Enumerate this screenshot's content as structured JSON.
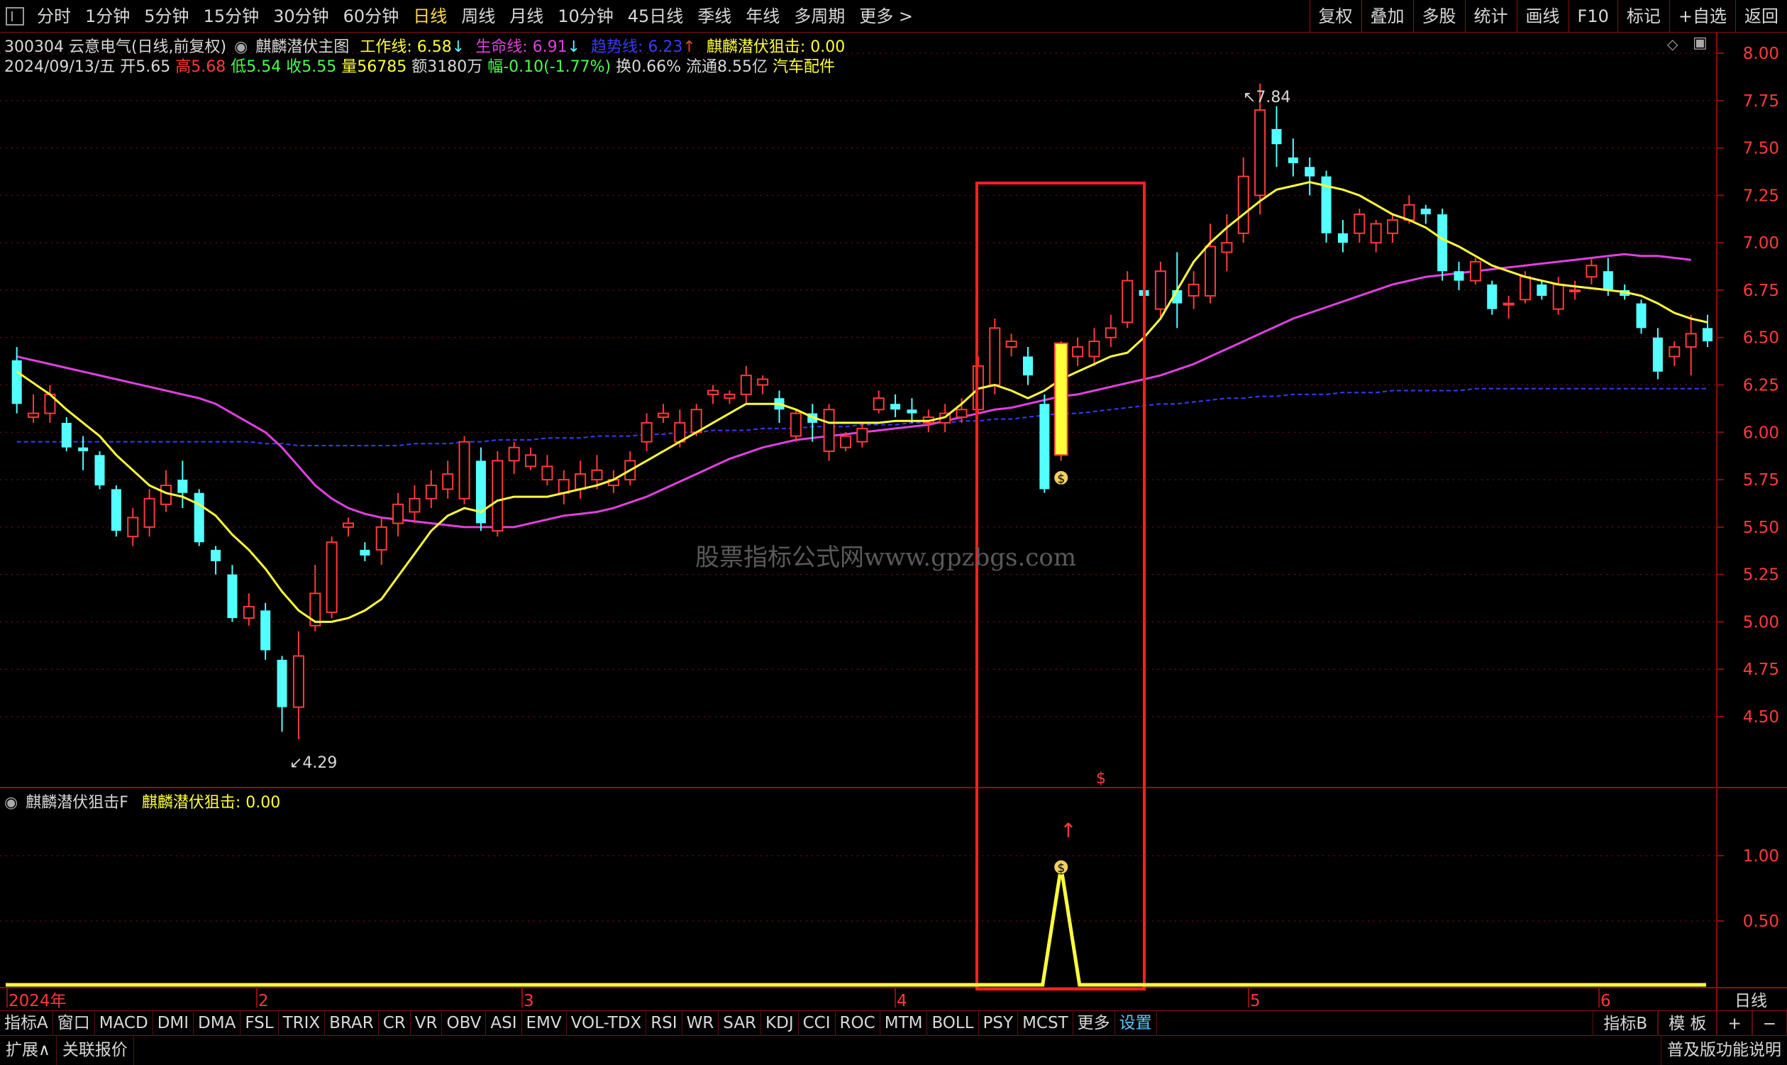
{
  "toolbar": {
    "periods": [
      "分时",
      "1分钟",
      "5分钟",
      "15分钟",
      "30分钟",
      "60分钟",
      "日线",
      "周线",
      "月线",
      "10分钟",
      "45日线",
      "季线",
      "年线",
      "多周期",
      "更多 >"
    ],
    "active_period": "日线",
    "right_tools": [
      "复权",
      "叠加",
      "多股",
      "统计",
      "画线",
      "F10",
      "标记",
      "+自选",
      "返回"
    ]
  },
  "header": {
    "stock": "300304 云意电气(日线,前复权)",
    "indicator_name": "麒麟潜伏主图",
    "work_line": "工作线: 6.58",
    "life_line": "生命线: 6.91",
    "trend_line": "趋势线: 6.23",
    "strike": "麒麟潜伏狙击: 0.00",
    "info_date": "2024/09/13/五",
    "info_open": "开5.65",
    "info_high": "高5.68",
    "info_low": "低5.54",
    "info_close": "收5.55",
    "info_vol": "量56785",
    "info_amount": "额3180万",
    "info_change": "幅-0.10(-1.77%)",
    "info_turnover": "换0.66%",
    "info_float": "流通8.55亿",
    "info_sector": "汽车配件"
  },
  "annotations": {
    "max_label": "7.84",
    "min_label": "4.29",
    "signal_glyph": "$"
  },
  "sub_panel": {
    "title": "麒麟潜伏狙击F",
    "value_label": "麒麟潜伏狙击: 0.00"
  },
  "axis_labels": {
    "month_labels": [
      "2024年",
      "2",
      "3",
      "4",
      "5",
      "6"
    ],
    "period_box": "日线"
  },
  "watermark": "股票指标公式网www.gpzbgs.com",
  "bottom_tabs": [
    "指标A",
    "窗口",
    "MACD",
    "DMI",
    "DMA",
    "FSL",
    "TRIX",
    "BRAR",
    "CR",
    "VR",
    "OBV",
    "ASI",
    "EMV",
    "VOL-TDX",
    "RSI",
    "WR",
    "SAR",
    "KDJ",
    "CCI",
    "ROC",
    "MTM",
    "BOLL",
    "PSY",
    "MCST",
    "更多",
    "设置"
  ],
  "bottom_right": [
    "指标B",
    "模 板",
    "+",
    "−"
  ],
  "status": {
    "expand": "扩展∧",
    "related": "关联报价",
    "right": "普及版功能说明"
  },
  "colors": {
    "up": "#ff3a3a",
    "down": "#54ffff",
    "yellow": "#ffff3a",
    "magenta": "#e040e0",
    "blue": "#3a3aff",
    "grid": "#8a1010",
    "signal_box": "#ff2020"
  },
  "chart_data": [
    {
      "type": "candlestick",
      "title": "麒麟潜伏主图",
      "ylim": [
        4.25,
        8.05
      ],
      "y_ticks": [
        8.0,
        7.75,
        7.5,
        7.25,
        7.0,
        6.75,
        6.5,
        6.25,
        6.0,
        5.75,
        5.5,
        5.25,
        5.0,
        4.75,
        4.5
      ],
      "candles": [
        [
          6.38,
          6.15,
          6.45,
          6.1
        ],
        [
          6.08,
          6.1,
          6.2,
          6.05
        ],
        [
          6.1,
          6.2,
          6.25,
          6.05
        ],
        [
          6.05,
          5.92,
          6.08,
          5.9
        ],
        [
          5.92,
          5.9,
          5.98,
          5.8
        ],
        [
          5.88,
          5.72,
          5.9,
          5.7
        ],
        [
          5.7,
          5.48,
          5.72,
          5.45
        ],
        [
          5.45,
          5.55,
          5.6,
          5.4
        ],
        [
          5.5,
          5.65,
          5.7,
          5.45
        ],
        [
          5.62,
          5.72,
          5.8,
          5.58
        ],
        [
          5.75,
          5.68,
          5.85,
          5.6
        ],
        [
          5.68,
          5.42,
          5.7,
          5.4
        ],
        [
          5.38,
          5.32,
          5.4,
          5.25
        ],
        [
          5.25,
          5.02,
          5.3,
          5.0
        ],
        [
          5.02,
          5.08,
          5.15,
          4.98
        ],
        [
          5.06,
          4.85,
          5.1,
          4.8
        ],
        [
          4.8,
          4.55,
          4.82,
          4.42
        ],
        [
          4.55,
          4.82,
          4.95,
          4.38
        ],
        [
          4.98,
          5.15,
          5.3,
          4.95
        ],
        [
          5.05,
          5.42,
          5.45,
          5.02
        ],
        [
          5.5,
          5.52,
          5.55,
          5.45
        ],
        [
          5.38,
          5.35,
          5.42,
          5.32
        ],
        [
          5.38,
          5.5,
          5.55,
          5.3
        ],
        [
          5.52,
          5.62,
          5.68,
          5.45
        ],
        [
          5.58,
          5.65,
          5.72,
          5.52
        ],
        [
          5.65,
          5.72,
          5.8,
          5.6
        ],
        [
          5.7,
          5.78,
          5.85,
          5.65
        ],
        [
          5.65,
          5.95,
          5.98,
          5.62
        ],
        [
          5.85,
          5.52,
          5.92,
          5.48
        ],
        [
          5.48,
          5.85,
          5.9,
          5.45
        ],
        [
          5.85,
          5.92,
          5.95,
          5.78
        ],
        [
          5.82,
          5.88,
          5.92,
          5.8
        ],
        [
          5.75,
          5.82,
          5.88,
          5.72
        ],
        [
          5.68,
          5.75,
          5.8,
          5.62
        ],
        [
          5.7,
          5.78,
          5.85,
          5.65
        ],
        [
          5.75,
          5.8,
          5.88,
          5.7
        ],
        [
          5.72,
          5.75,
          5.8,
          5.68
        ],
        [
          5.75,
          5.85,
          5.9,
          5.72
        ],
        [
          5.95,
          6.05,
          6.1,
          5.9
        ],
        [
          6.08,
          6.1,
          6.15,
          6.05
        ],
        [
          5.95,
          6.05,
          6.12,
          5.92
        ],
        [
          6.0,
          6.12,
          6.15,
          5.98
        ],
        [
          6.2,
          6.22,
          6.25,
          6.15
        ],
        [
          6.18,
          6.2,
          6.22,
          6.15
        ],
        [
          6.2,
          6.3,
          6.35,
          6.15
        ],
        [
          6.25,
          6.28,
          6.3,
          6.2
        ],
        [
          6.18,
          6.12,
          6.22,
          6.05
        ],
        [
          5.98,
          6.1,
          6.12,
          5.95
        ],
        [
          6.1,
          6.05,
          6.15,
          5.95
        ],
        [
          5.9,
          6.12,
          6.15,
          5.85
        ],
        [
          5.92,
          5.98,
          6.0,
          5.9
        ],
        [
          5.95,
          6.02,
          6.05,
          5.92
        ],
        [
          6.12,
          6.18,
          6.22,
          6.1
        ],
        [
          6.15,
          6.12,
          6.2,
          6.08
        ],
        [
          6.12,
          6.1,
          6.18,
          6.05
        ],
        [
          6.05,
          6.08,
          6.12,
          6.0
        ],
        [
          6.05,
          6.1,
          6.15,
          6.0
        ],
        [
          6.08,
          6.12,
          6.18,
          6.05
        ],
        [
          6.12,
          6.35,
          6.4,
          6.1
        ],
        [
          6.25,
          6.55,
          6.6,
          6.2
        ],
        [
          6.45,
          6.48,
          6.52,
          6.4
        ],
        [
          6.4,
          6.3,
          6.45,
          6.25
        ],
        [
          6.15,
          5.7,
          6.2,
          5.68
        ],
        [
          5.9,
          6.45,
          6.48,
          5.85
        ],
        [
          6.4,
          6.45,
          6.5,
          6.35
        ],
        [
          6.4,
          6.48,
          6.55,
          6.35
        ],
        [
          6.5,
          6.55,
          6.62,
          6.45
        ],
        [
          6.58,
          6.8,
          6.85,
          6.55
        ],
        [
          6.75,
          6.72,
          6.95,
          6.4
        ],
        [
          6.65,
          6.85,
          6.9,
          6.6
        ],
        [
          6.75,
          6.68,
          6.95,
          6.55
        ],
        [
          6.72,
          6.78,
          6.85,
          6.65
        ],
        [
          6.72,
          6.98,
          7.1,
          6.68
        ],
        [
          6.95,
          7.0,
          7.15,
          6.85
        ],
        [
          7.05,
          7.35,
          7.45,
          7.0
        ],
        [
          7.25,
          7.7,
          7.84,
          7.15
        ],
        [
          7.6,
          7.52,
          7.72,
          7.4
        ],
        [
          7.45,
          7.42,
          7.55,
          7.35
        ],
        [
          7.4,
          7.35,
          7.45,
          7.25
        ],
        [
          7.35,
          7.05,
          7.38,
          7.0
        ],
        [
          7.05,
          7.0,
          7.12,
          6.95
        ],
        [
          7.05,
          7.15,
          7.18,
          7.0
        ],
        [
          7.0,
          7.1,
          7.12,
          6.95
        ],
        [
          7.05,
          7.12,
          7.15,
          7.0
        ],
        [
          7.12,
          7.2,
          7.25,
          7.1
        ],
        [
          7.18,
          7.15,
          7.2,
          7.1
        ],
        [
          7.15,
          6.85,
          7.18,
          6.8
        ],
        [
          6.85,
          6.8,
          6.9,
          6.75
        ],
        [
          6.8,
          6.9,
          6.92,
          6.78
        ],
        [
          6.78,
          6.65,
          6.8,
          6.62
        ],
        [
          6.68,
          6.68,
          6.72,
          6.6
        ],
        [
          6.7,
          6.82,
          6.85,
          6.68
        ],
        [
          6.78,
          6.72,
          6.8,
          6.7
        ],
        [
          6.65,
          6.78,
          6.82,
          6.62
        ],
        [
          6.75,
          6.75,
          6.8,
          6.7
        ],
        [
          6.82,
          6.88,
          6.92,
          6.78
        ],
        [
          6.85,
          6.75,
          6.92,
          6.72
        ],
        [
          6.75,
          6.72,
          6.78,
          6.7
        ],
        [
          6.68,
          6.55,
          6.7,
          6.52
        ],
        [
          6.5,
          6.32,
          6.55,
          6.28
        ],
        [
          6.4,
          6.45,
          6.48,
          6.35
        ],
        [
          6.45,
          6.52,
          6.62,
          6.3
        ],
        [
          6.55,
          6.48,
          6.62,
          6.45
        ]
      ],
      "work_line": [
        6.32,
        6.26,
        6.2,
        6.12,
        6.05,
        5.98,
        5.88,
        5.8,
        5.72,
        5.68,
        5.66,
        5.62,
        5.56,
        5.46,
        5.38,
        5.28,
        5.16,
        5.06,
        5.0,
        5.0,
        5.02,
        5.06,
        5.12,
        5.24,
        5.36,
        5.48,
        5.56,
        5.6,
        5.58,
        5.64,
        5.66,
        5.66,
        5.66,
        5.68,
        5.7,
        5.72,
        5.75,
        5.8,
        5.85,
        5.9,
        5.95,
        6.0,
        6.05,
        6.1,
        6.15,
        6.15,
        6.15,
        6.12,
        6.08,
        6.05,
        6.05,
        6.05,
        6.05,
        6.06,
        6.06,
        6.06,
        6.08,
        6.15,
        6.23,
        6.25,
        6.22,
        6.18,
        6.22,
        6.28,
        6.32,
        6.36,
        6.4,
        6.42,
        6.5,
        6.6,
        6.75,
        6.9,
        7.0,
        7.08,
        7.15,
        7.22,
        7.28,
        7.3,
        7.32,
        7.3,
        7.28,
        7.25,
        7.2,
        7.15,
        7.12,
        7.08,
        7.02,
        6.98,
        6.93,
        6.88,
        6.85,
        6.82,
        6.8,
        6.78,
        6.77,
        6.76,
        6.75,
        6.74,
        6.72,
        6.68,
        6.63,
        6.6,
        6.58
      ],
      "life_line": [
        6.4,
        6.38,
        6.36,
        6.34,
        6.32,
        6.3,
        6.28,
        6.26,
        6.24,
        6.22,
        6.2,
        6.18,
        6.15,
        6.1,
        6.05,
        6.0,
        5.92,
        5.82,
        5.72,
        5.65,
        5.6,
        5.57,
        5.55,
        5.54,
        5.53,
        5.52,
        5.51,
        5.5,
        5.5,
        5.5,
        5.5,
        5.52,
        5.54,
        5.56,
        5.57,
        5.58,
        5.6,
        5.63,
        5.66,
        5.7,
        5.74,
        5.78,
        5.82,
        5.86,
        5.89,
        5.92,
        5.94,
        5.96,
        5.97,
        5.98,
        5.99,
        6.0,
        6.01,
        6.02,
        6.03,
        6.04,
        6.06,
        6.08,
        6.1,
        6.12,
        6.13,
        6.15,
        6.17,
        6.19,
        6.2,
        6.22,
        6.24,
        6.26,
        6.28,
        6.3,
        6.33,
        6.36,
        6.4,
        6.44,
        6.48,
        6.52,
        6.56,
        6.6,
        6.63,
        6.66,
        6.69,
        6.72,
        6.75,
        6.78,
        6.8,
        6.82,
        6.83,
        6.84,
        6.85,
        6.86,
        6.87,
        6.88,
        6.89,
        6.9,
        6.91,
        6.92,
        6.93,
        6.94,
        6.93,
        6.93,
        6.92,
        6.91
      ],
      "trend_line": [
        5.95,
        5.95,
        5.95,
        5.95,
        5.95,
        5.95,
        5.95,
        5.95,
        5.95,
        5.95,
        5.95,
        5.95,
        5.95,
        5.95,
        5.95,
        5.94,
        5.94,
        5.93,
        5.93,
        5.93,
        5.93,
        5.93,
        5.93,
        5.93,
        5.94,
        5.94,
        5.94,
        5.95,
        5.95,
        5.96,
        5.96,
        5.96,
        5.97,
        5.97,
        5.97,
        5.98,
        5.98,
        5.98,
        5.99,
        5.99,
        6.0,
        6.0,
        6.01,
        6.01,
        6.01,
        6.02,
        6.02,
        6.02,
        6.03,
        6.03,
        6.03,
        6.04,
        6.04,
        6.04,
        6.05,
        6.05,
        6.05,
        6.06,
        6.06,
        6.07,
        6.07,
        6.08,
        6.09,
        6.1,
        6.1,
        6.11,
        6.12,
        6.13,
        6.14,
        6.15,
        6.15,
        6.16,
        6.17,
        6.18,
        6.18,
        6.19,
        6.19,
        6.2,
        6.2,
        6.2,
        6.21,
        6.21,
        6.21,
        6.22,
        6.22,
        6.22,
        6.22,
        6.22,
        6.23,
        6.23,
        6.23,
        6.23,
        6.23,
        6.23,
        6.23,
        6.23,
        6.23,
        6.23,
        6.23,
        6.23,
        6.23,
        6.23,
        6.23
      ],
      "signal_index": 62,
      "signal_box_index_range": [
        57,
        66
      ]
    },
    {
      "type": "line",
      "title": "麒麟潜伏狙击F",
      "ylim": [
        0,
        1.4
      ],
      "y_ticks": [
        1.0,
        0.5
      ],
      "signal_index": 62,
      "values_note_signal_peak": 1
    }
  ]
}
